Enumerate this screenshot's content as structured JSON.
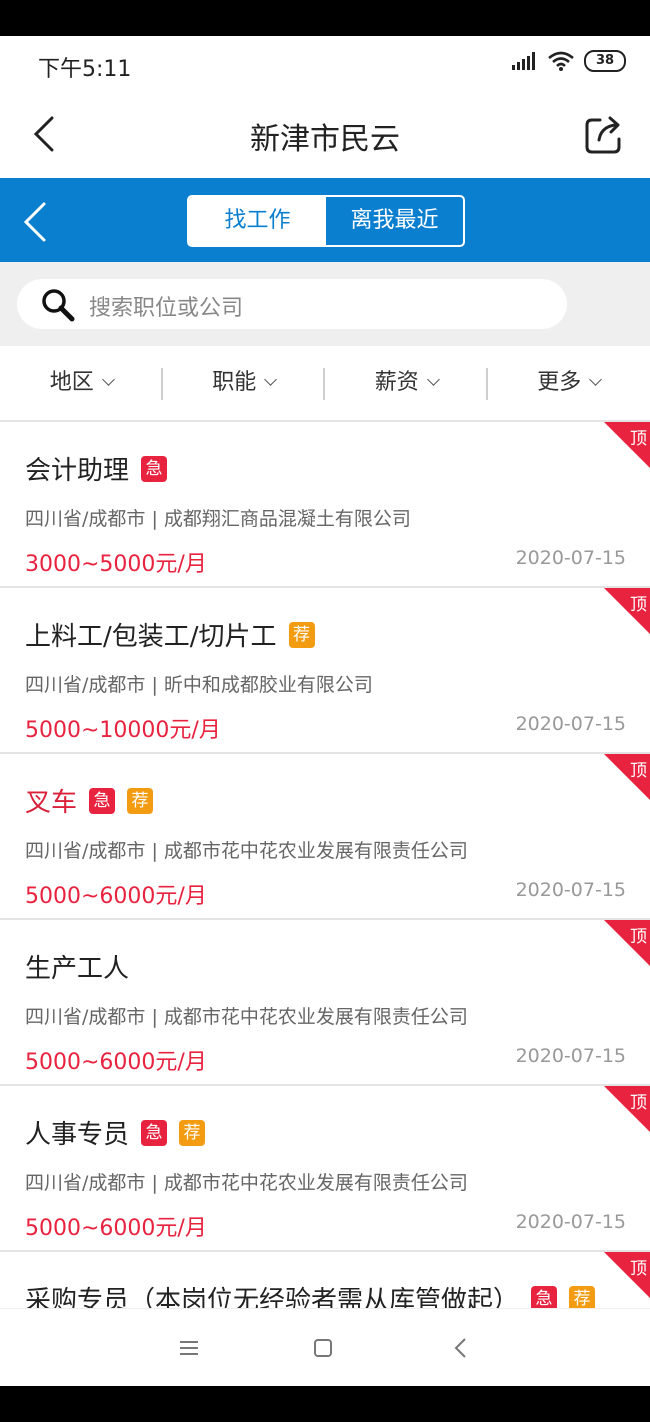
{
  "status": {
    "time": "下午5:11",
    "battery": "38"
  },
  "header": {
    "title": "新津市民云"
  },
  "tabs": {
    "active": "找工作",
    "inactive": "离我最近"
  },
  "search": {
    "placeholder": "搜索职位或公司"
  },
  "filters": [
    "地区",
    "职能",
    "薪资",
    "更多"
  ],
  "badges": {
    "urgent": "急",
    "recommend": "荐",
    "top": "顶"
  },
  "jobs": [
    {
      "title": "会计助理",
      "company": "四川省/成都市 | 成都翔汇商品混凝土有限公司",
      "salary": "3000~5000元/月",
      "date": "2020-07-15"
    },
    {
      "title": "上料工/包装工/切片工",
      "company": "四川省/成都市 | 昕中和成都胶业有限公司",
      "salary": "5000~10000元/月",
      "date": "2020-07-15"
    },
    {
      "title": "叉车",
      "company": "四川省/成都市 | 成都市花中花农业发展有限责任公司",
      "salary": "5000~6000元/月",
      "date": "2020-07-15"
    },
    {
      "title": "生产工人",
      "company": "四川省/成都市 | 成都市花中花农业发展有限责任公司",
      "salary": "5000~6000元/月",
      "date": "2020-07-15"
    },
    {
      "title": "人事专员",
      "company": "四川省/成都市 | 成都市花中花农业发展有限责任公司",
      "salary": "5000~6000元/月",
      "date": "2020-07-15"
    },
    {
      "title": "采购专员（本岗位无经验者需从库管做起）",
      "company": "",
      "salary": "",
      "date": ""
    }
  ],
  "colors": {
    "primary_blue": "#0a7fd0",
    "urgent_red": "#e8233f",
    "recommend_orange": "#f39c12"
  }
}
